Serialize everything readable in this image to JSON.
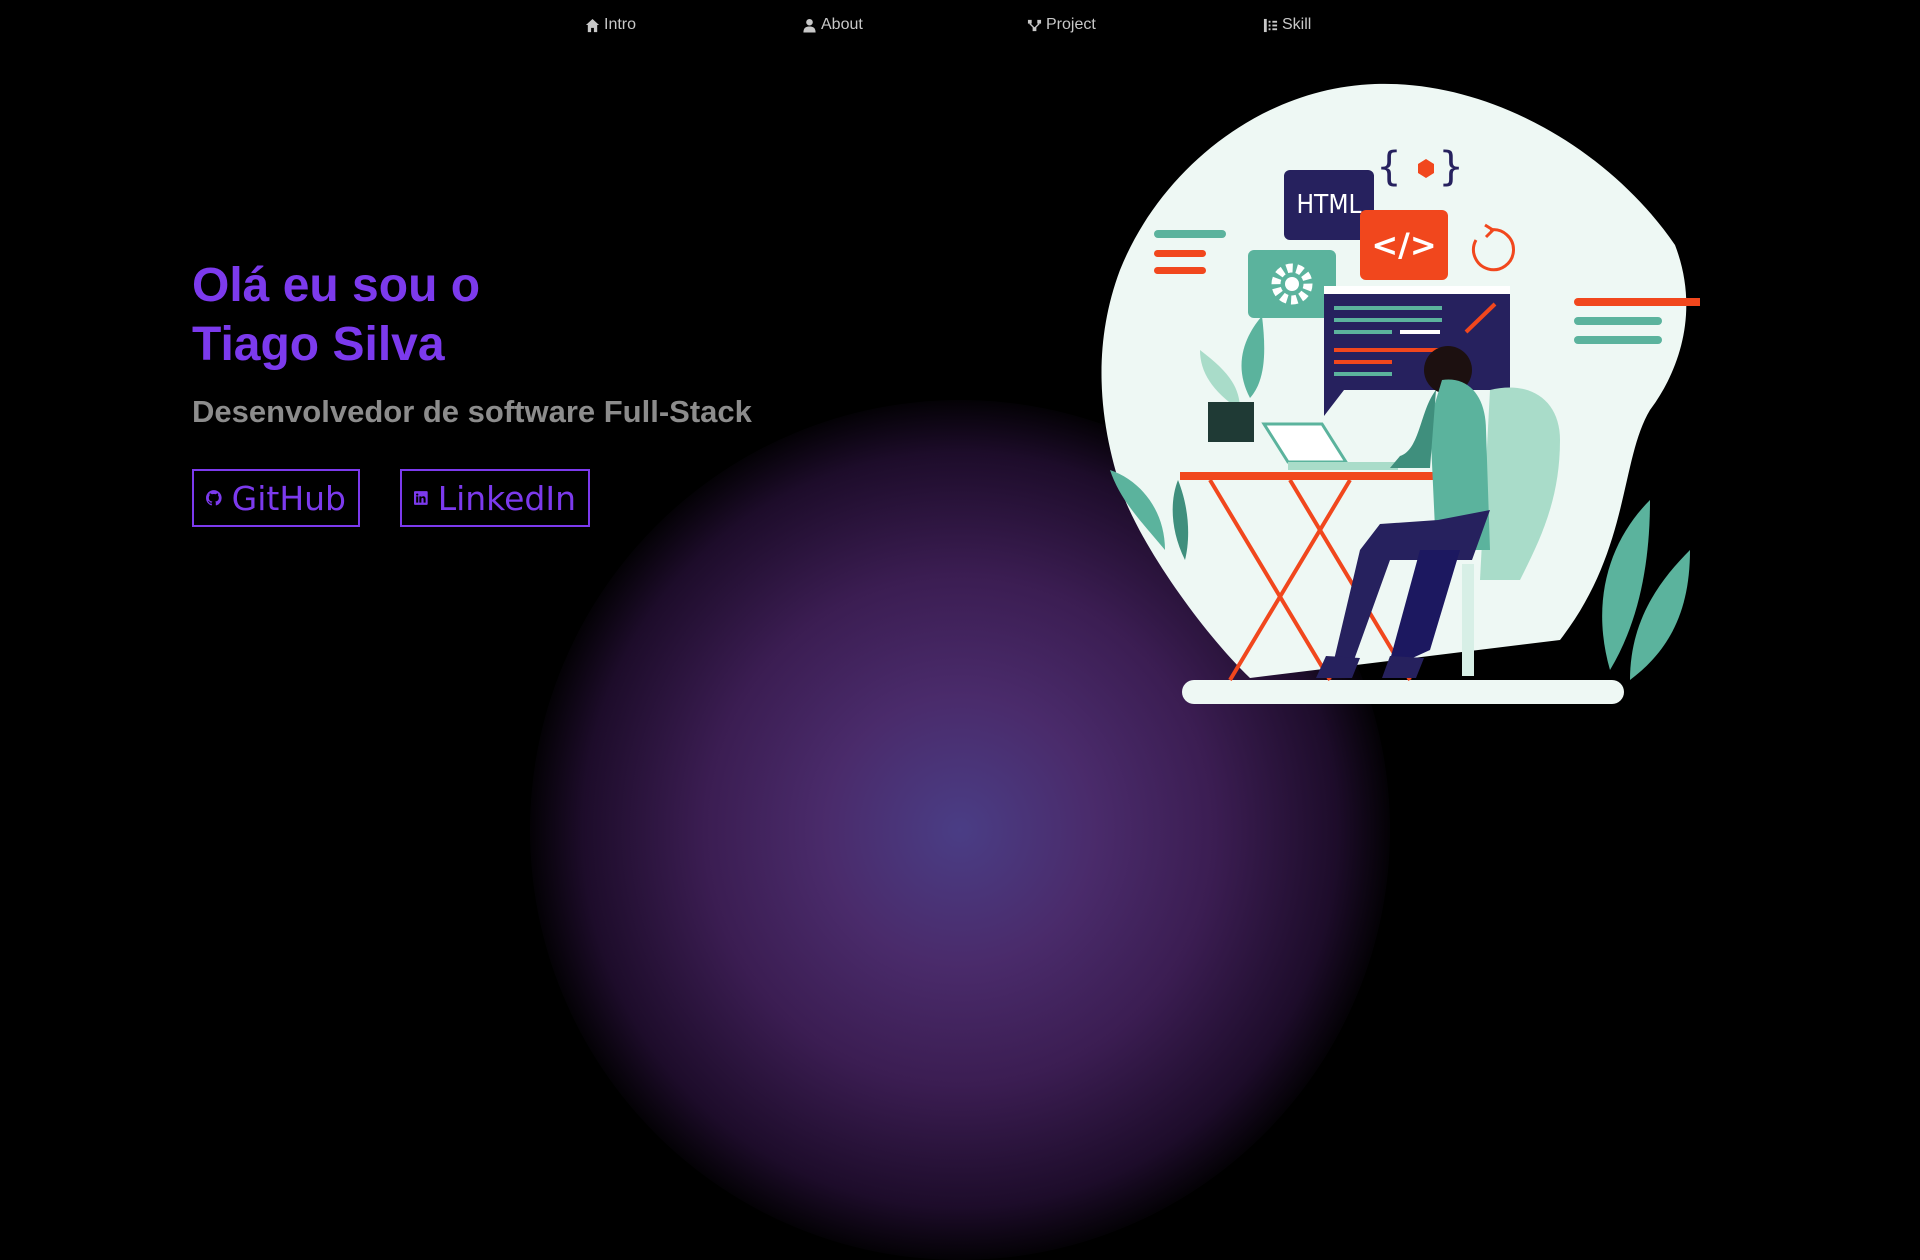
{
  "nav": {
    "items": [
      {
        "label": "Intro",
        "icon": "home-icon"
      },
      {
        "label": "About",
        "icon": "user-icon"
      },
      {
        "label": "Project",
        "icon": "project-icon"
      },
      {
        "label": "Skill",
        "icon": "skill-icon"
      }
    ]
  },
  "hero": {
    "greeting_line1": "Olá eu sou o",
    "greeting_line2": "Tiago Silva",
    "subtitle": "Desenvolvedor de software Full-Stack",
    "github_label": "GitHub",
    "linkedin_label": "LinkedIn"
  },
  "illustration": {
    "html_badge": "HTML",
    "code_badge": "</>",
    "brace_badge": "{ }"
  },
  "colors": {
    "accent": "#7c3aed",
    "subtitle": "#8c8c8c",
    "nav_text": "#c8c8c8",
    "background": "#000000"
  }
}
